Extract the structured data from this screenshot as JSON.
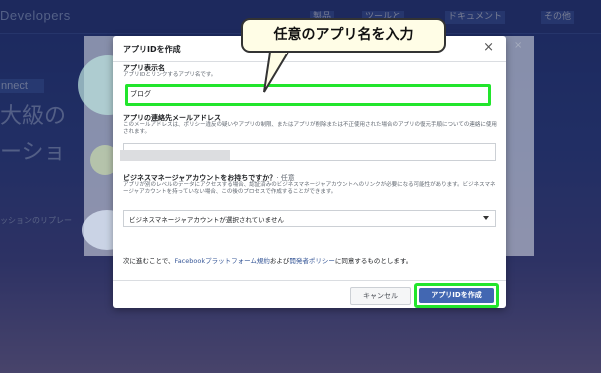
{
  "background": {
    "brand": "Developers",
    "nav_items": [
      "製品",
      "ツールと",
      "ドキュメント",
      "その他"
    ],
    "connect": "nnect",
    "headline_1": "大級の",
    "headline_2": "ーショ",
    "subtext": "ッションのリプレー"
  },
  "modal": {
    "title": "アプリIDを作成",
    "close": "×",
    "display_name": {
      "label": "アプリ表示名",
      "help": "アプリIDとリンクするアプリ名です。",
      "value": "ブログ"
    },
    "contact_email": {
      "label": "アプリの連絡先メールアドレス",
      "help": "このメールアドレスは、ポリシー違反の疑いやアプリの制限、またはアプリが削除または不正使用された場合のアプリの復元手順についての連絡に使用されます。"
    },
    "business_account": {
      "label": "ビジネスマネージャアカウントをお持ちですか？",
      "optional": "· 任意",
      "help": "アプリが別のレベルのデータにアクセスする場合、認証済みのビジネスマネージャアカウントへのリンクが必要になる可能性があります。ビジネスマネージャアカウントを持っていない場合、この後のプロセスで作成することができます。",
      "selected": "ビジネスマネージャアカウントが選択されていません"
    },
    "terms": {
      "prefix": "次に進むことで、",
      "platform_policy": "Facebookプラットフォーム規約",
      "middle": "および",
      "developer_policy": "開発者ポリシー",
      "suffix": "に同意するものとします。"
    },
    "cancel": "キャンセル",
    "create": "アプリIDを作成"
  },
  "callout": {
    "text": "任意のアプリ名を入力"
  },
  "colors": {
    "highlight": "#22e52c",
    "primary_button": "#4267b2",
    "link": "#385898"
  }
}
